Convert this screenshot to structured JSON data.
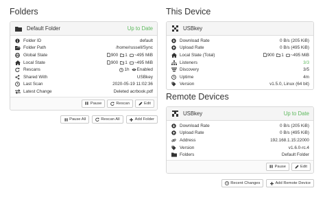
{
  "folders": {
    "heading": "Folders",
    "panel": {
      "title": "Default Folder",
      "status": "Up to Date",
      "rows": [
        {
          "icon": "info-icon",
          "label": "Folder ID",
          "value": "default"
        },
        {
          "icon": "folder-open-icon",
          "label": "Folder Path",
          "value": "/home/russell/Sync"
        },
        {
          "icon": "globe-icon",
          "label": "Global State",
          "files": "900",
          "dirs": "1",
          "size": "~495 MiB"
        },
        {
          "icon": "home-icon",
          "label": "Local State",
          "files": "900",
          "dirs": "1",
          "size": "~495 MiB"
        },
        {
          "icon": "refresh-icon",
          "label": "Rescans",
          "interval": "1h",
          "watcher": "Enabled"
        },
        {
          "icon": "share-icon",
          "label": "Shared With",
          "value": "USBkey"
        },
        {
          "icon": "clock-icon",
          "label": "Last Scan",
          "value": "2020-05-19 11:02:36"
        },
        {
          "icon": "exchange-icon",
          "label": "Latest Change",
          "value": "Deleted acrbook.pdf"
        }
      ],
      "buttons": [
        "Pause",
        "Rescan",
        "Edit"
      ]
    },
    "bottom_buttons": [
      "Pause All",
      "Rescan All",
      "Add Folder"
    ]
  },
  "this_device": {
    "heading": "This Device",
    "panel": {
      "title": "USBkey",
      "rows": [
        {
          "icon": "download-icon",
          "label": "Download Rate",
          "value": "0 B/s (205 KiB)"
        },
        {
          "icon": "upload-icon",
          "label": "Upload Rate",
          "value": "0 B/s (495 KiB)"
        },
        {
          "icon": "home-icon",
          "label": "Local State (Total)",
          "files": "900",
          "dirs": "1",
          "size": "~495 MiB"
        },
        {
          "icon": "sitemap-icon",
          "label": "Listeners",
          "value": "3/3",
          "color": "#5cb85c"
        },
        {
          "icon": "discovery-icon",
          "label": "Discovery",
          "value": "3/5"
        },
        {
          "icon": "clock-icon",
          "label": "Uptime",
          "value": "4m"
        },
        {
          "icon": "tag-icon",
          "label": "Version",
          "value": "v1.5.0, Linux (64 bit)"
        }
      ]
    }
  },
  "remote_devices": {
    "heading": "Remote Devices",
    "panel": {
      "title": "USBkey",
      "status": "Up to Date",
      "rows": [
        {
          "icon": "download-icon",
          "label": "Download Rate",
          "value": "0 B/s (205 KiB)"
        },
        {
          "icon": "upload-icon",
          "label": "Upload Rate",
          "value": "0 B/s (495 KiB)"
        },
        {
          "icon": "link-icon",
          "label": "Address",
          "value": "192.168.1.15:22000"
        },
        {
          "icon": "tag-icon",
          "label": "Version",
          "value": "v1.6.0-rc.4"
        },
        {
          "icon": "folder-icon",
          "label": "Folders",
          "value": "Default Folder"
        }
      ],
      "buttons": [
        "Pause",
        "Edit"
      ]
    },
    "bottom_buttons": [
      "Recent Changes",
      "Add Remote Device"
    ]
  },
  "colors": {
    "status_green": "#5cb85c",
    "panel_header": "#f5f5f5",
    "border": "#d7d7d7"
  }
}
